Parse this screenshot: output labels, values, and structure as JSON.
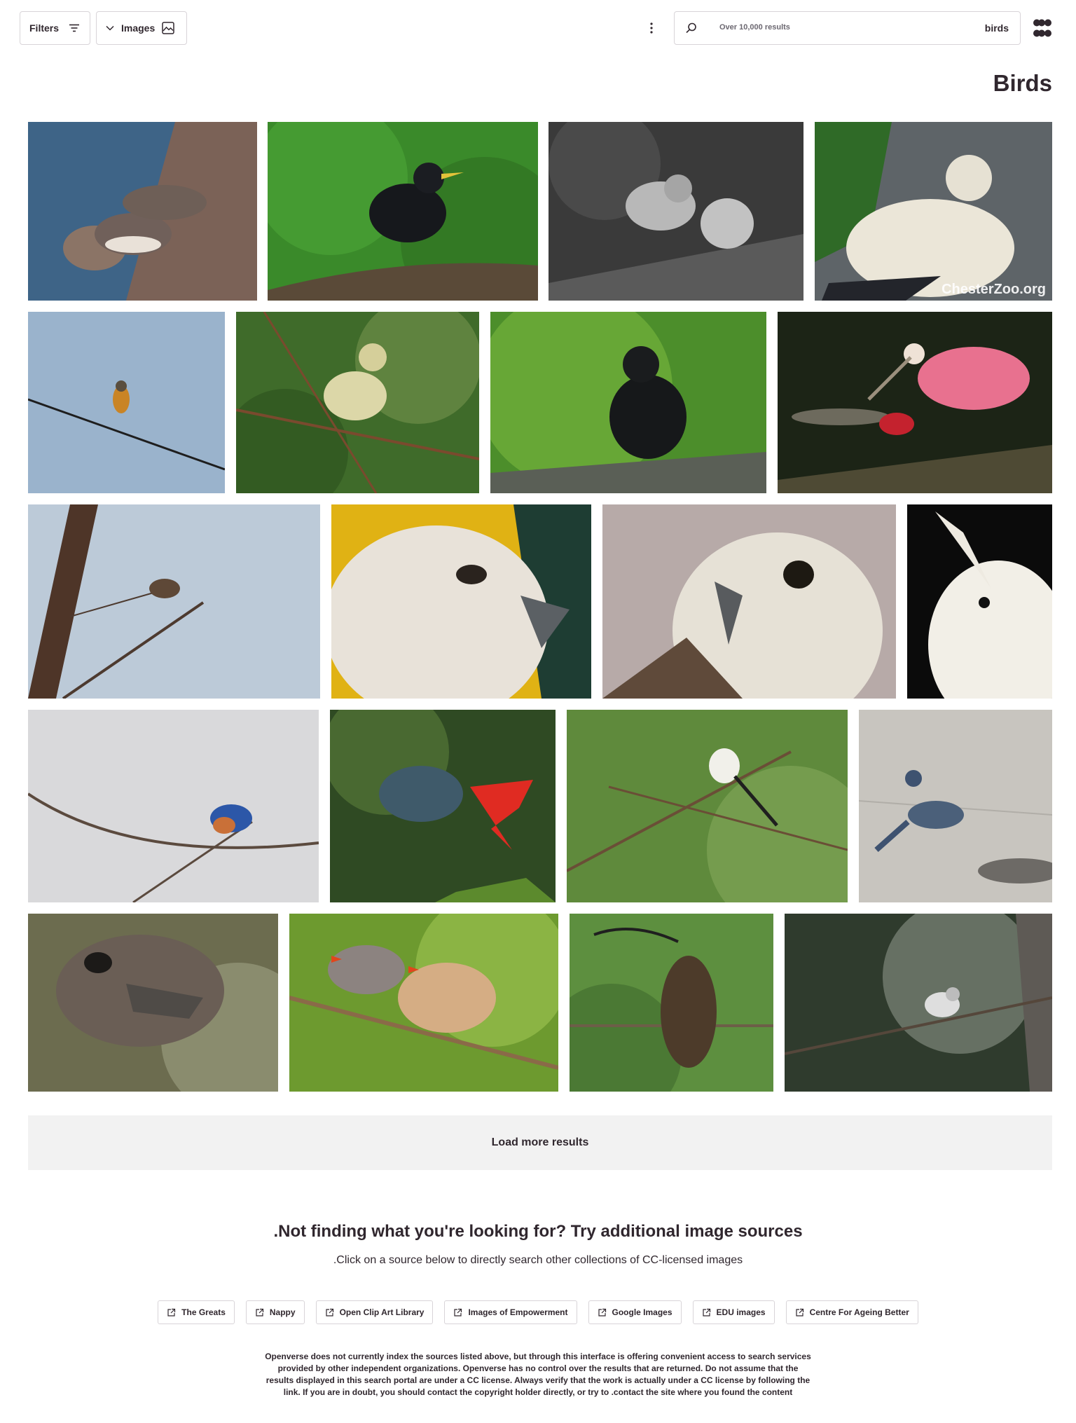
{
  "header": {
    "filters_label": "Filters",
    "content_type_label": "Images",
    "search_count": "Over 10,000 results",
    "search_query": "birds"
  },
  "page_title": "Birds",
  "results": [
    {
      "subject": "geese"
    },
    {
      "subject": "starling"
    },
    {
      "subject": "sparrows"
    },
    {
      "subject": "pied imperial pigeon",
      "watermark": "ChesterZoo.org"
    },
    {
      "subject": "robin on wire"
    },
    {
      "subject": "warbler in branches"
    },
    {
      "subject": "starling"
    },
    {
      "subject": "roseate spoonbill"
    },
    {
      "subject": "bird on tree"
    },
    {
      "subject": "falcon"
    },
    {
      "subject": "saker falcon"
    },
    {
      "subject": "cockatiel"
    },
    {
      "subject": "eastern bluebird"
    },
    {
      "subject": "hummingbird"
    },
    {
      "subject": "scissor-tailed flycatcher"
    },
    {
      "subject": "scrub jay"
    },
    {
      "subject": "ostrich"
    },
    {
      "subject": "zebra finches"
    },
    {
      "subject": "scythebill"
    },
    {
      "subject": "mockingbird"
    }
  ],
  "load_more_label": "Load more results",
  "sources": {
    "title": ".Not finding what you're looking for? Try additional image sources",
    "subtitle": ".Click on a source below to directly search other collections of CC-licensed images",
    "items": [
      "The Greats",
      "Nappy",
      "Open Clip Art Library",
      "Images of Empowerment",
      "Google Images",
      "EDU images",
      "Centre For Ageing Better"
    ],
    "disclaimer": "Openverse does not currently index the sources listed above, but through this interface is offering convenient access to search services provided by other independent organizations. Openverse has no control over the results that are returned. Do not assume that the results displayed in this search portal are under a CC license. Always verify that the work is actually under a CC license by following the link. If you are in doubt, you should contact the copyright holder directly, or try to .contact the site where you found the content"
  },
  "colors": {
    "text": "#30272e",
    "border": "#d8d4d8",
    "load_more_bg": "#f2f2f2"
  }
}
